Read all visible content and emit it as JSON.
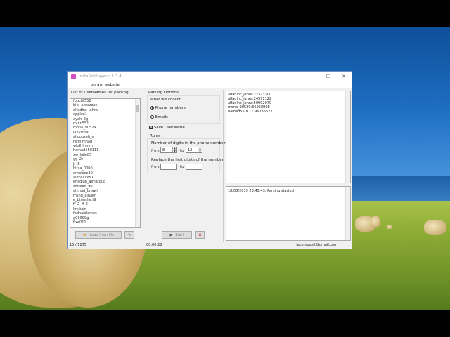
{
  "window": {
    "title": "InstaGotPlayer v.1.3.4",
    "menu_item": "ogram website"
  },
  "left": {
    "header": "List of UserNames for parsing",
    "users": [
      "fpucht552",
      "bilx_alwazzan",
      "alfadlnc_jahra",
      "applex1",
      "ayah_2g",
      "m.r.r.551",
      "mona_90529",
      "lahyshr9",
      "shoousah_s",
      "rahhimhad",
      "wkdhlmnrh",
      "hamad550111",
      "xw_laile85",
      "gg_2t",
      "jl_j5",
      "hifaa_0000",
      "dmplexx30",
      "aldnsaxx57",
      "khadjah_almatouq",
      "sofreen_90",
      "ahmad_bnawi",
      "mshd_alnakh",
      "e_btoushe.t9",
      "ff_2_ff_2",
      "knutain",
      "fadhalalemes",
      "g09999g",
      "fixe011"
    ],
    "load_btn": "Load from file",
    "count": "15 / 1175"
  },
  "options": {
    "header": "Parsing Options",
    "collect_label": "What we collect",
    "opt_phone": "Phone numbers",
    "opt_emails": "Emails",
    "save_username": "Save UserName",
    "rules": "Rules",
    "digits_label": "Number of digits in the phone number",
    "from": "from",
    "to": "to",
    "from_val": "8",
    "to_val": "12",
    "replace_label": "Replace the first digits of the number",
    "start_btn": "Start",
    "timer": "00:00:28"
  },
  "results": [
    "alfadlnc_jahra:22323300",
    "alfadlnc_jahra:24571122",
    "alfadlnc_jahra:50992070",
    "mona_90529:66958908",
    "hamad550111:96735672"
  ],
  "log": [
    "18/03/2019 23:45:43: Parsing started"
  ],
  "email": "jacomosoft@gmail.com"
}
